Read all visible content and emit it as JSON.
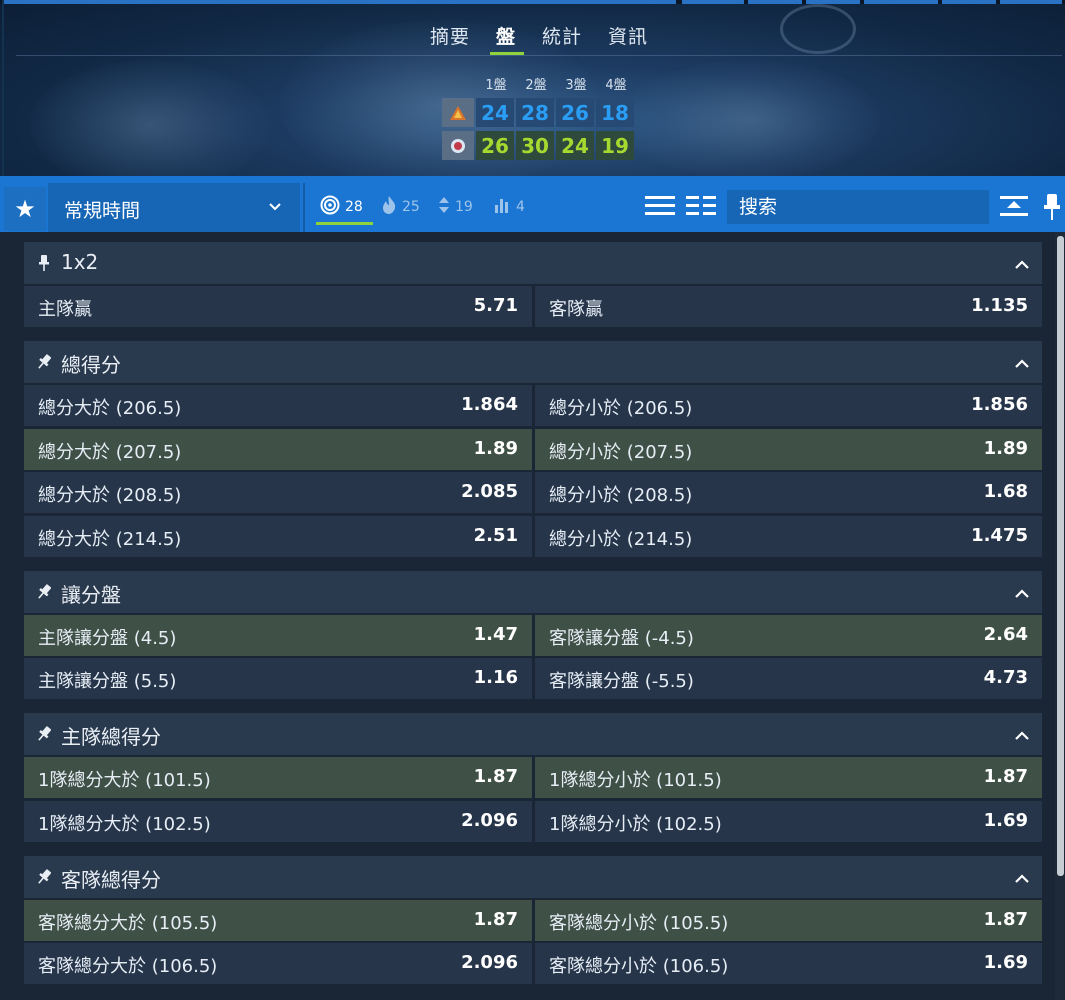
{
  "hero": {
    "tabs": [
      {
        "label": "摘要",
        "active": false
      },
      {
        "label": "盤",
        "active": true
      },
      {
        "label": "統計",
        "active": false
      },
      {
        "label": "資訊",
        "active": false
      }
    ],
    "set_labels": [
      "1盤",
      "2盤",
      "3盤",
      "4盤"
    ],
    "teams": [
      {
        "icon": "team-home-logo-icon",
        "scores": [
          "24",
          "28",
          "26",
          "18"
        ]
      },
      {
        "icon": "team-away-logo-icon",
        "scores": [
          "26",
          "30",
          "24",
          "19"
        ]
      }
    ],
    "colors": {
      "accent_green": "#8fd33a",
      "home_score": "#2a9df4",
      "away_score": "#a6d930"
    }
  },
  "toolbar": {
    "period_select": "常規時間",
    "stats": [
      {
        "icon": "target-icon",
        "count": "28",
        "active": true
      },
      {
        "icon": "fire-icon",
        "count": "25",
        "active": false
      },
      {
        "icon": "up-down-arrows-icon",
        "count": "19",
        "active": false
      },
      {
        "icon": "bar-chart-icon",
        "count": "4",
        "active": false
      }
    ],
    "search_placeholder": "搜索",
    "colors": {
      "bar": "#1a76d2"
    }
  },
  "markets": [
    {
      "title": "1x2",
      "rows": [
        {
          "highlight": false,
          "left": {
            "label": "主隊贏",
            "odds": "5.71"
          },
          "right": {
            "label": "客隊贏",
            "odds": "1.135"
          }
        }
      ]
    },
    {
      "title": "總得分",
      "rows": [
        {
          "highlight": false,
          "left": {
            "label": "總分大於 (206.5)",
            "odds": "1.864"
          },
          "right": {
            "label": "總分小於 (206.5)",
            "odds": "1.856"
          }
        },
        {
          "highlight": true,
          "left": {
            "label": "總分大於 (207.5)",
            "odds": "1.89"
          },
          "right": {
            "label": "總分小於 (207.5)",
            "odds": "1.89"
          }
        },
        {
          "highlight": false,
          "left": {
            "label": "總分大於 (208.5)",
            "odds": "2.085"
          },
          "right": {
            "label": "總分小於 (208.5)",
            "odds": "1.68"
          }
        },
        {
          "highlight": false,
          "left": {
            "label": "總分大於 (214.5)",
            "odds": "2.51"
          },
          "right": {
            "label": "總分小於 (214.5)",
            "odds": "1.475"
          }
        }
      ]
    },
    {
      "title": "讓分盤",
      "rows": [
        {
          "highlight": true,
          "left": {
            "label": "主隊讓分盤 (4.5)",
            "odds": "1.47"
          },
          "right": {
            "label": "客隊讓分盤 (-4.5)",
            "odds": "2.64"
          }
        },
        {
          "highlight": false,
          "left": {
            "label": "主隊讓分盤 (5.5)",
            "odds": "1.16"
          },
          "right": {
            "label": "客隊讓分盤 (-5.5)",
            "odds": "4.73"
          }
        }
      ]
    },
    {
      "title": "主隊總得分",
      "rows": [
        {
          "highlight": true,
          "left": {
            "label": "1隊總分大於 (101.5)",
            "odds": "1.87"
          },
          "right": {
            "label": "1隊總分小於 (101.5)",
            "odds": "1.87"
          }
        },
        {
          "highlight": false,
          "left": {
            "label": "1隊總分大於 (102.5)",
            "odds": "2.096"
          },
          "right": {
            "label": "1隊總分小於 (102.5)",
            "odds": "1.69"
          }
        }
      ]
    },
    {
      "title": "客隊總得分",
      "rows": [
        {
          "highlight": true,
          "left": {
            "label": "客隊總分大於 (105.5)",
            "odds": "1.87"
          },
          "right": {
            "label": "客隊總分小於 (105.5)",
            "odds": "1.87"
          }
        },
        {
          "highlight": false,
          "left": {
            "label": "客隊總分大於 (106.5)",
            "odds": "2.096"
          },
          "right": {
            "label": "客隊總分小於 (106.5)",
            "odds": "1.69"
          }
        }
      ]
    }
  ]
}
